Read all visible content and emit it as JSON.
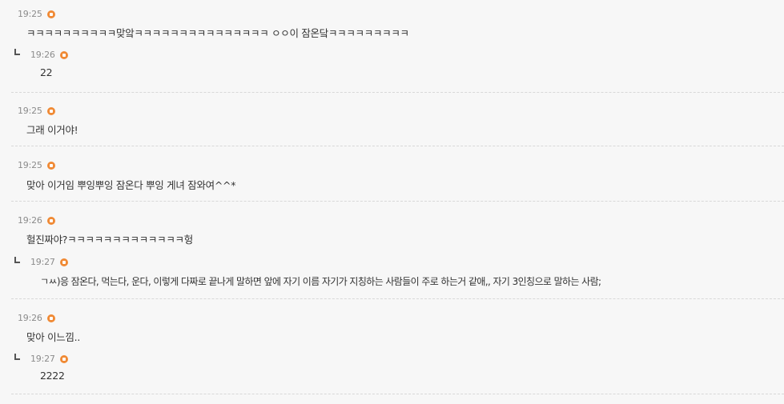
{
  "comments": [
    {
      "time": "19:25",
      "text": "ㅋㅋㅋㅋㅋㅋㅋㅋㅋㅋ맞앜ㅋㅋㅋㅋㅋㅋㅋㅋㅋㅋㅋㅋㅋㅋㅋ ㅇㅇ이 잠온닼ㅋㅋㅋㅋㅋㅋㅋㅋㅋ",
      "reply": {
        "time": "19:26",
        "text": "22"
      }
    },
    {
      "time": "19:25",
      "text": "그래 이거야!"
    },
    {
      "time": "19:25",
      "text": "맞아 이거임 뿌잉뿌잉 잠온다 뿌잉 게녀 잠와여^^*"
    },
    {
      "time": "19:26",
      "text": "헐진짜야?ㅋㅋㅋㅋㅋㅋㅋㅋㅋㅋㅋㅋㅋ헝",
      "reply": {
        "time": "19:27",
        "text": "ㄱㅆ)응 잠온다, 먹는다, 운다, 이렇게 다짜로 끝나게 말하면 앞에 자기 이름 자기가 지칭하는 사람들이 주로 하는거 같애,, 자기 3인칭으로 말하는 사람;"
      }
    },
    {
      "time": "19:26",
      "text": "맞아 이느낌..",
      "reply": {
        "time": "19:27",
        "text": "2222"
      }
    }
  ],
  "colors": {
    "background": "#f7f7f7",
    "badge": "#f08a35",
    "timestamp": "#8c8c8c",
    "text": "#333333"
  },
  "icons": {
    "badge": "n-badge-icon",
    "reply": "reply-arrow-icon"
  }
}
